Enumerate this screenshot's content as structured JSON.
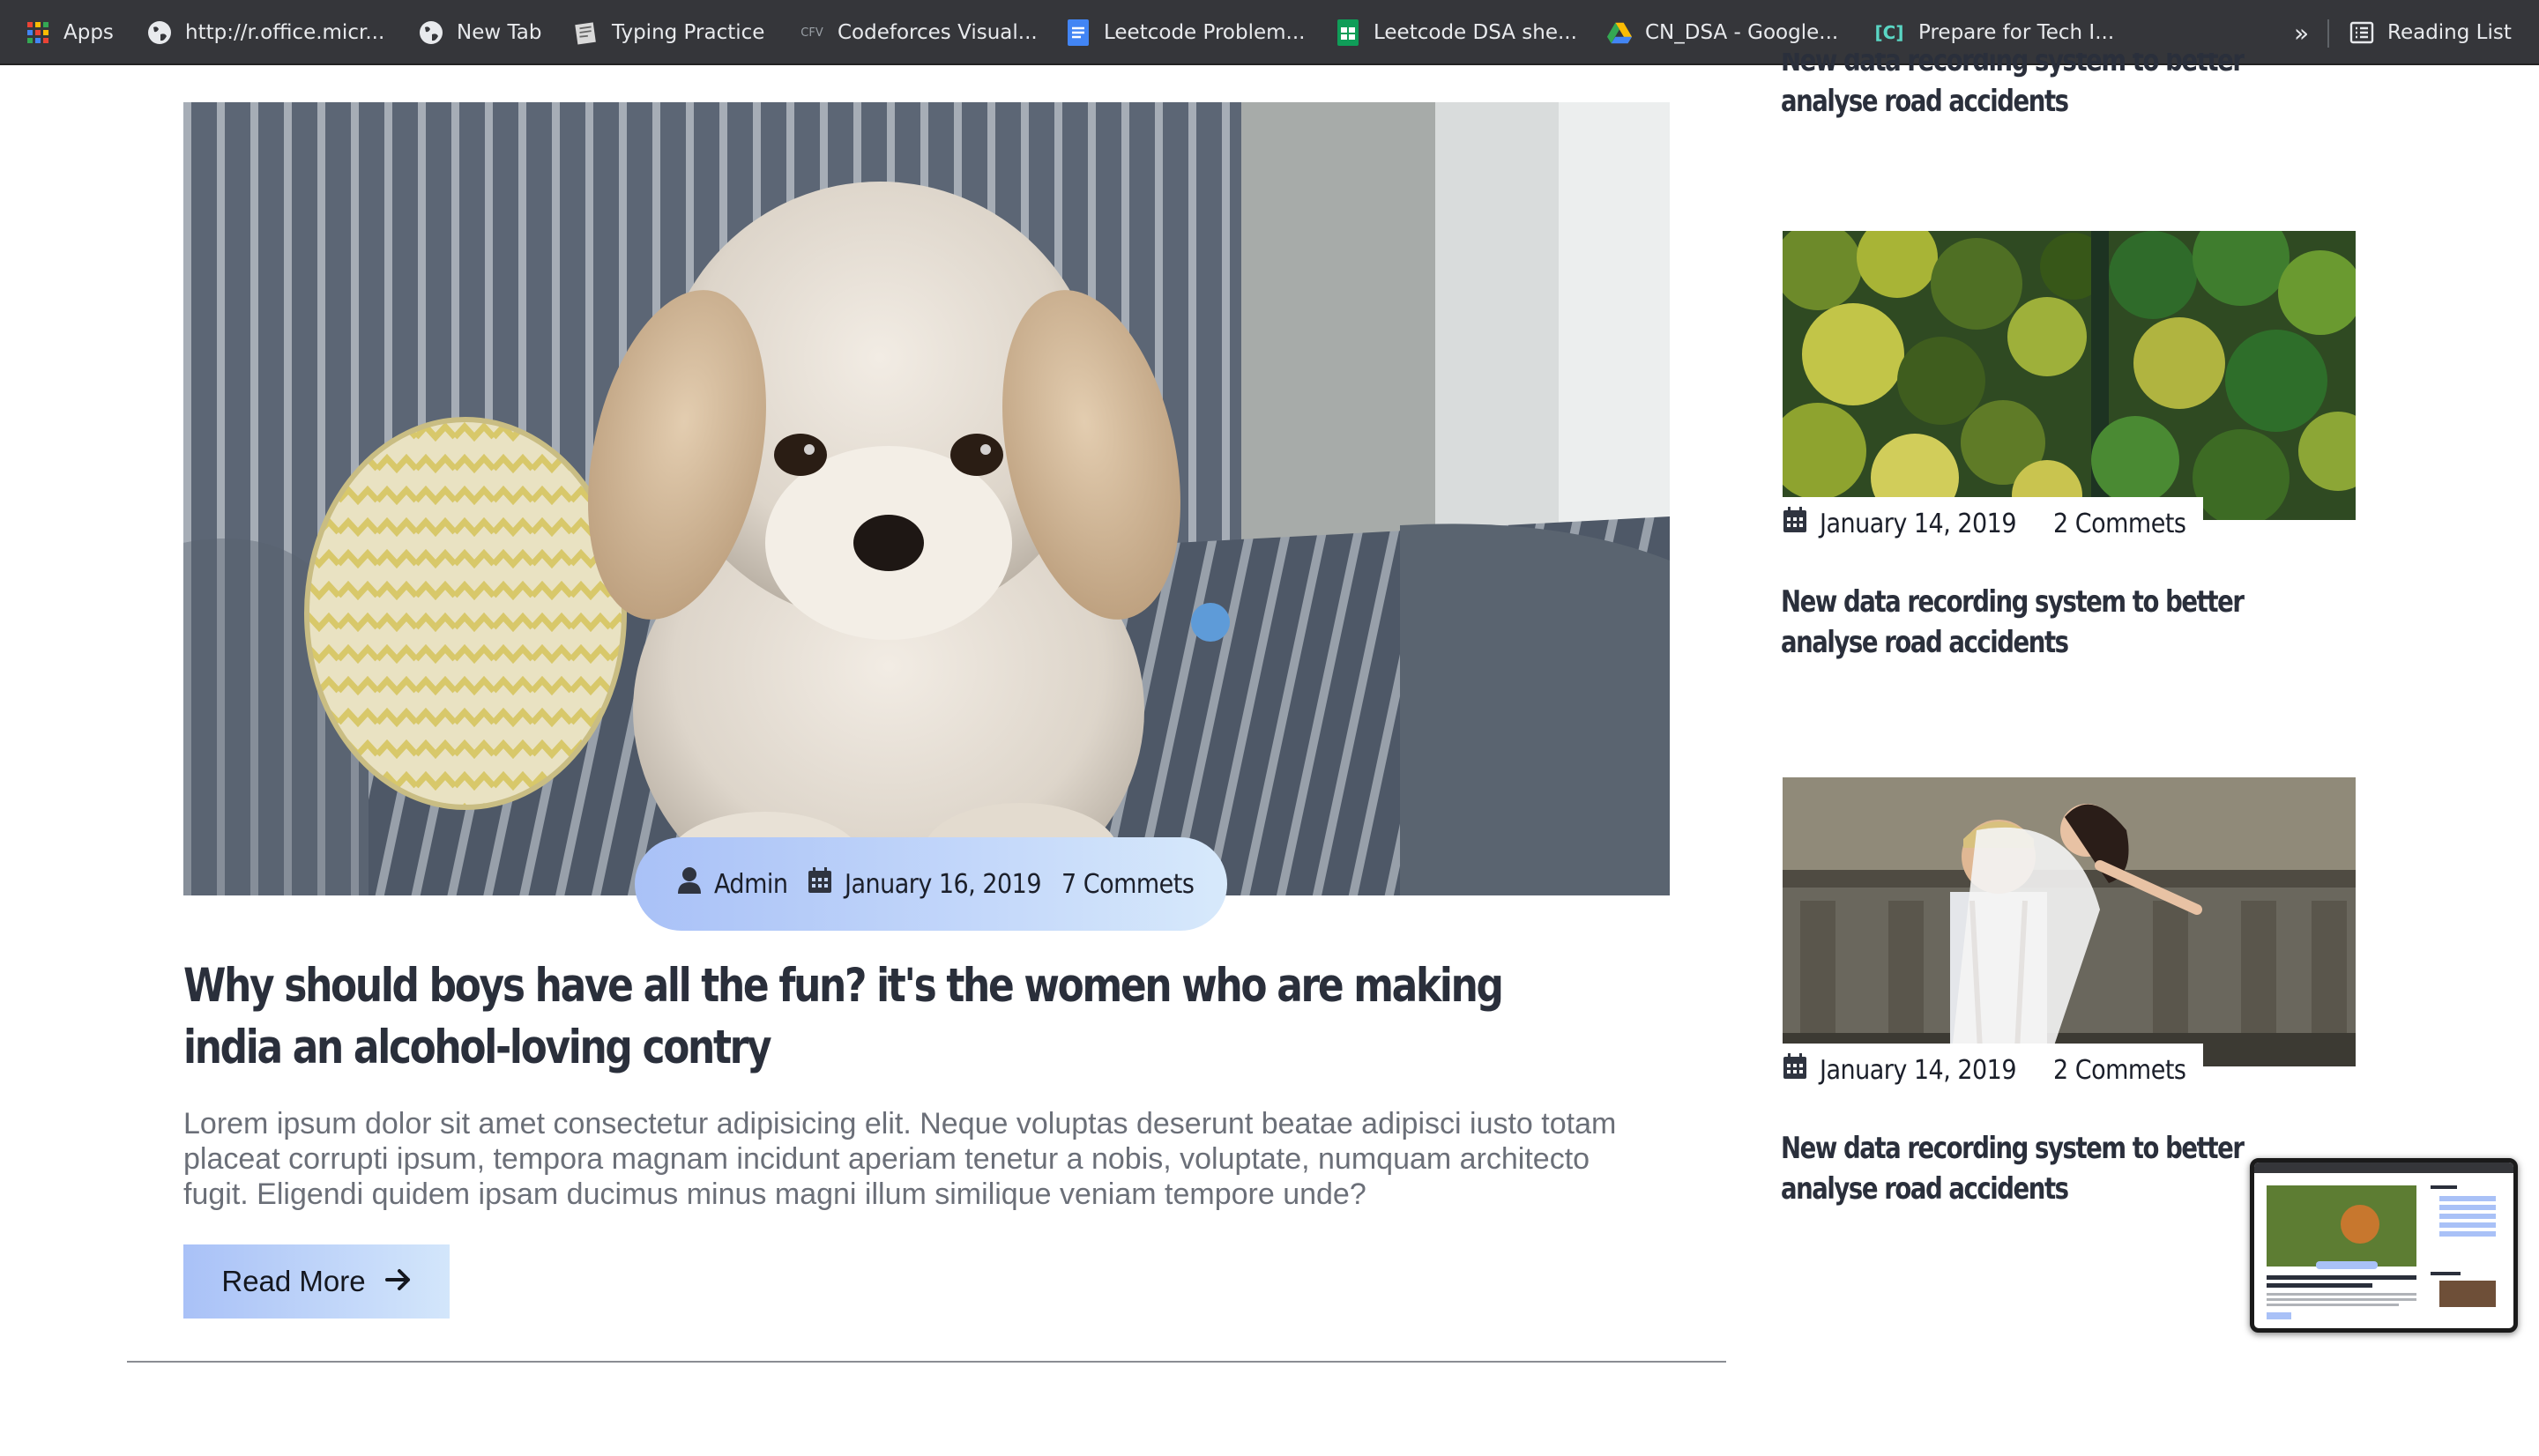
{
  "bookmarks": {
    "items": [
      {
        "label": "Apps",
        "icon": "apps-grid-icon"
      },
      {
        "label": "http://r.office.micr...",
        "icon": "globe-icon"
      },
      {
        "label": "New Tab",
        "icon": "globe-icon"
      },
      {
        "label": "Typing Practice",
        "icon": "typing-icon"
      },
      {
        "label": "Codeforces Visual...",
        "icon": "cfv-icon",
        "icon_text": "CFV"
      },
      {
        "label": "Leetcode Problem...",
        "icon": "google-docs-icon"
      },
      {
        "label": "Leetcode DSA she...",
        "icon": "google-sheets-icon"
      },
      {
        "label": "CN_DSA - Google...",
        "icon": "google-drive-icon"
      },
      {
        "label": "Prepare for Tech I...",
        "icon": "code-bracket-icon",
        "icon_text": "[C]"
      }
    ],
    "more": "»",
    "reading_list": "Reading List"
  },
  "main_post": {
    "author": "Admin",
    "date": "January 16, 2019",
    "comments": "7 Commets",
    "title": "Why should boys have all the fun? it's the women who are making india an alcohol-loving contry",
    "excerpt": "Lorem ipsum dolor sit amet consectetur adipisicing elit. Neque voluptas deserunt beatae adipisci iusto totam placeat corrupti ipsum, tempora magnam incidunt aperiam tenetur a nobis, voluptate, numquam architecto fugit. Eligendi quidem ipsam ducimus minus magni illum similique veniam tempore unde?",
    "read_more": "Read More"
  },
  "sidebar": {
    "top_title": "New data recording system to better analyse road accidents",
    "posts": [
      {
        "date": "January 14, 2019",
        "comments": "2 Commets",
        "title": "New data recording system to better analyse road accidents"
      },
      {
        "date": "January 14, 2019",
        "comments": "2 Commets",
        "title": "New data recording system to better analyse road accidents"
      }
    ]
  },
  "colors": {
    "accent_gradient_start": "#a9c1f7",
    "accent_gradient_end": "#d7e9fb",
    "heading": "#2a2f3b",
    "body_text": "#6b6f78",
    "bookmarks_bg": "#35363a"
  }
}
